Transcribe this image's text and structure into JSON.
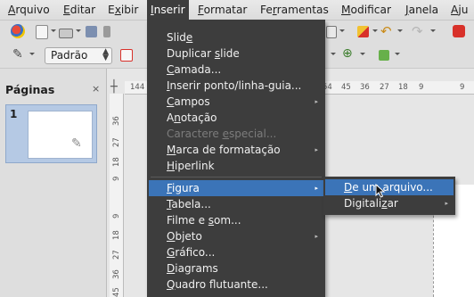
{
  "menubar": [
    {
      "label": "Arquivo",
      "accel": "A",
      "rest": "rquivo"
    },
    {
      "label": "Editar",
      "accel": "E",
      "rest": "ditar"
    },
    {
      "label": "Exibir",
      "pre": "E",
      "accel": "x",
      "rest": "ibir"
    },
    {
      "label": "Inserir",
      "accel": "I",
      "rest": "nserir"
    },
    {
      "label": "Formatar",
      "accel": "F",
      "rest": "ormatar"
    },
    {
      "label": "Ferramentas",
      "pre": "Fe",
      "accel": "r",
      "rest": "ramentas"
    },
    {
      "label": "Modificar",
      "accel": "M",
      "rest": "odificar"
    },
    {
      "label": "Janela",
      "accel": "J",
      "rest": "anela"
    },
    {
      "label": "Aju",
      "accel": "A",
      "rest": "ju"
    }
  ],
  "toolbar": {
    "style_value": "Padrão"
  },
  "pages_pane": {
    "title": "Páginas",
    "close": "×",
    "slide_number": "1"
  },
  "ruler": {
    "h_ticks": [
      "144",
      "54",
      "45",
      "36",
      "27",
      "18",
      "9",
      "9"
    ],
    "v_ticks": [
      "36",
      "27",
      "18",
      "9",
      "9",
      "18",
      "27",
      "36",
      "45"
    ]
  },
  "insert_menu": {
    "items": [
      {
        "pre": "Slid",
        "accel": "e",
        "post": "",
        "enabled": true,
        "submenu": false
      },
      {
        "pre": "Duplicar ",
        "accel": "s",
        "post": "lide",
        "enabled": true,
        "submenu": false
      },
      {
        "pre": "",
        "accel": "C",
        "post": "amada...",
        "enabled": true,
        "submenu": false
      },
      {
        "pre": "",
        "accel": "I",
        "post": "nserir ponto/linha-guia...",
        "enabled": true,
        "submenu": false
      },
      {
        "pre": "",
        "accel": "C",
        "post": "ampos",
        "enabled": true,
        "submenu": true
      },
      {
        "pre": "A",
        "accel": "n",
        "post": "otação",
        "enabled": true,
        "submenu": false
      },
      {
        "pre": "Caractere ",
        "accel": "e",
        "post": "special...",
        "enabled": false,
        "submenu": false
      },
      {
        "pre": "",
        "accel": "M",
        "post": "arca de formatação",
        "enabled": true,
        "submenu": true
      },
      {
        "pre": "",
        "accel": "H",
        "post": "iperlink",
        "enabled": true,
        "submenu": false
      },
      {
        "pre": "",
        "accel": "F",
        "post": "igura",
        "enabled": true,
        "submenu": true,
        "highlighted": true
      },
      {
        "pre": "",
        "accel": "T",
        "post": "abela...",
        "enabled": true,
        "submenu": false
      },
      {
        "pre": "Filme e ",
        "accel": "s",
        "post": "om...",
        "enabled": true,
        "submenu": false
      },
      {
        "pre": "",
        "accel": "O",
        "post": "bjeto",
        "enabled": true,
        "submenu": true
      },
      {
        "pre": "",
        "accel": "G",
        "post": "ráfico...",
        "enabled": true,
        "submenu": false
      },
      {
        "pre": "",
        "accel": "D",
        "post": "iagrams",
        "enabled": true,
        "submenu": false
      },
      {
        "pre": "",
        "accel": "Q",
        "post": "uadro flutuante...",
        "enabled": true,
        "submenu": false
      }
    ]
  },
  "figura_submenu": {
    "items": [
      {
        "pre": "",
        "accel": "D",
        "post": "e um arquivo...",
        "highlighted": true,
        "submenu": false
      },
      {
        "pre": "Digitali",
        "accel": "z",
        "post": "ar",
        "highlighted": false,
        "submenu": true
      }
    ]
  },
  "colors": {
    "menu_bg": "#3d3d3d",
    "highlight": "#3b74b8",
    "accent_red": "#d8312a"
  }
}
